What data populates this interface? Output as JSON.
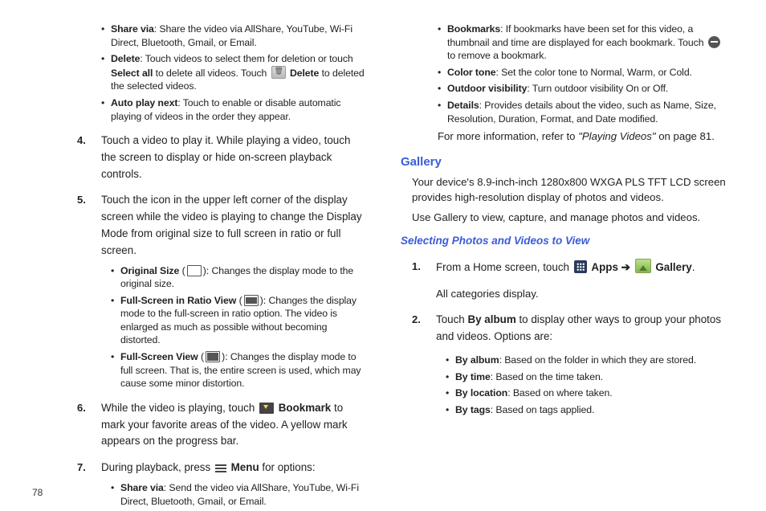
{
  "page_number": "78",
  "left": {
    "initial_bullets": [
      {
        "term": "Share via",
        "text": ": Share the video via AllShare, YouTube, Wi-Fi Direct, Bluetooth, Gmail, or Email."
      },
      {
        "term": "Delete",
        "text_a": ": Touch videos to select them for deletion or touch ",
        "strong_a": "Select all",
        "text_b": " to delete all videos. Touch ",
        "strong_b": "Delete",
        "text_c": " to deleted the selected videos."
      },
      {
        "term": "Auto play next",
        "text": ": Touch to enable or disable automatic playing of videos in the order they appear."
      }
    ],
    "step4": {
      "num": "4.",
      "text": "Touch a video to play it. While playing a video, touch the screen to display or hide on-screen playback controls."
    },
    "step5": {
      "num": "5.",
      "text": "Touch the icon in the upper left corner of the display screen while the video is playing to change the Display Mode from original size to full screen in ratio or full screen.",
      "bullets": [
        {
          "term": "Original Size",
          "tail": ": Changes the display mode to the original size."
        },
        {
          "term": "Full-Screen in Ratio View",
          "tail": ": Changes the display mode to the full-screen in ratio option. The video is enlarged as much as possible without becoming distorted."
        },
        {
          "term": "Full-Screen View",
          "tail": ": Changes the display mode to full screen. That is, the entire screen is used, which may cause some minor distortion."
        }
      ]
    },
    "step6": {
      "num": "6.",
      "text_a": "While the video is playing, touch ",
      "strong": "Bookmark",
      "text_b": " to mark your favorite areas of the video. A yellow mark appears on the progress bar."
    },
    "step7": {
      "num": "7.",
      "text_a": "During playback, press ",
      "strong": "Menu",
      "text_b": " for options:",
      "bullets": [
        {
          "term": "Share via",
          "text": ": Send the video via AllShare, YouTube, Wi-Fi Direct, Bluetooth, Gmail, or Email."
        }
      ]
    }
  },
  "right": {
    "top_bullets": [
      {
        "term": "Bookmarks",
        "text_a": ": If bookmarks have been set for this video, a thumbnail and time are displayed for each bookmark. Touch ",
        "text_b": " to remove a bookmark."
      },
      {
        "term": "Color tone",
        "text": ": Set the color tone to Normal, Warm, or Cold."
      },
      {
        "term": "Outdoor visibility",
        "text": ": Turn outdoor visibility On or Off."
      },
      {
        "term": "Details",
        "text": ": Provides details about the video, such as Name, Size, Resolution, Duration, Format, and Date modified."
      }
    ],
    "refer": {
      "pre": "For more information, refer to ",
      "em": "\"Playing Videos\"",
      "post": "  on page 81."
    },
    "gallery_heading": "Gallery",
    "gallery_p1": "Your device's 8.9-inch-inch 1280x800 WXGA PLS TFT LCD screen provides high-resolution display of photos and videos.",
    "gallery_p2": "Use Gallery to view, capture, and manage photos and videos.",
    "sub_heading": "Selecting Photos and Videos to View",
    "g_step1": {
      "num": "1.",
      "text_a": "From a Home screen, touch ",
      "apps": "Apps",
      "arrow": "➔",
      "gallery": "Gallery",
      "text_b": ".",
      "follow": "All categories display."
    },
    "g_step2": {
      "num": "2.",
      "text_a": "Touch ",
      "strong": "By album",
      "text_b": " to display other ways to group your photos and videos. Options are:",
      "bullets": [
        {
          "term": "By album",
          "text": ": Based on the folder in which they are stored."
        },
        {
          "term": "By time",
          "text": ": Based on the time taken."
        },
        {
          "term": "By location",
          "text": ": Based on where taken."
        },
        {
          "term": "By tags",
          "text": ": Based on tags applied."
        }
      ]
    }
  }
}
